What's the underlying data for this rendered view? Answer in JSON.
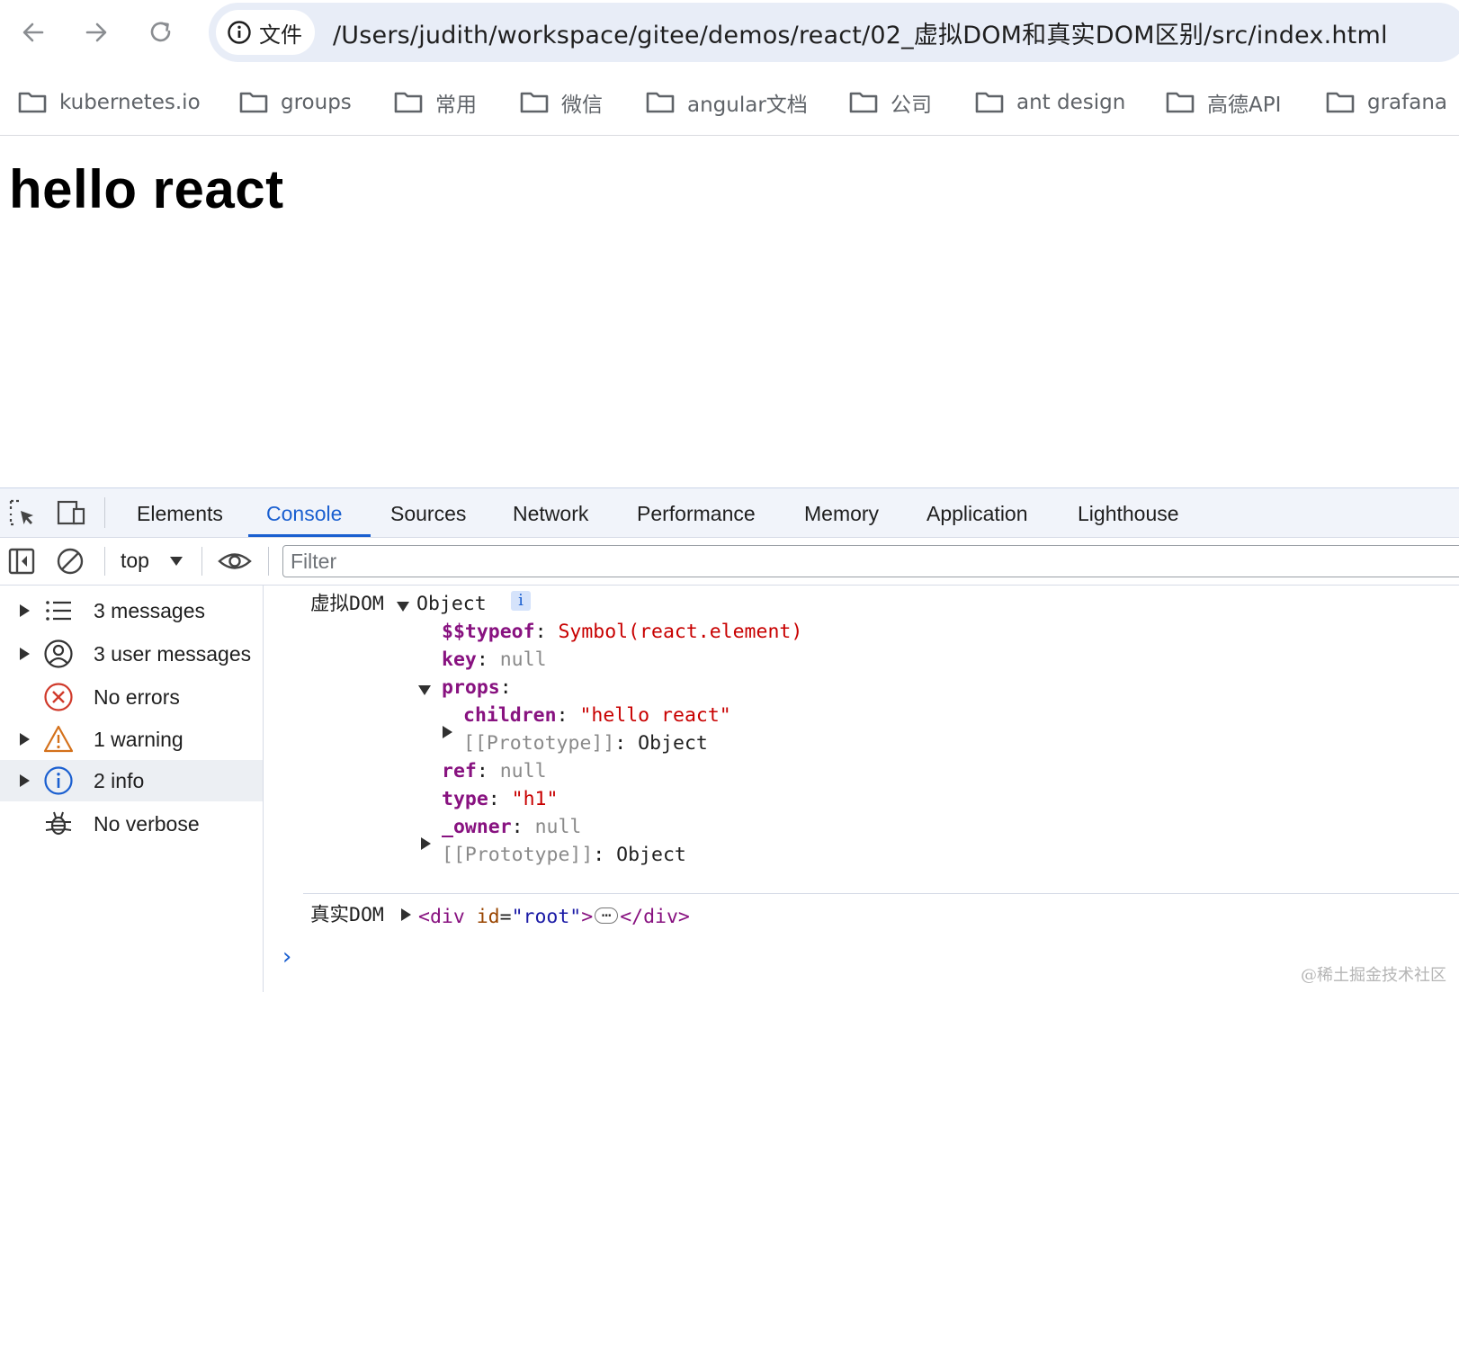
{
  "browser": {
    "site_info_label": "文件",
    "url": "/Users/judith/workspace/gitee/demos/react/02_虚拟DOM和真实DOM区别/src/index.html",
    "bookmarks": [
      "kubernetes.io",
      "groups",
      "常用",
      "微信",
      "angular文档",
      "公司",
      "ant design",
      "高德API",
      "grafana"
    ]
  },
  "page": {
    "heading": "hello react"
  },
  "devtools": {
    "tabs": [
      "Elements",
      "Console",
      "Sources",
      "Network",
      "Performance",
      "Memory",
      "Application",
      "Lighthouse"
    ],
    "active_tab": "Console",
    "accent_color": "#1a5fd0",
    "toolbar": {
      "context": "top",
      "filter_placeholder": "Filter"
    },
    "sidebar": [
      {
        "label": "3 messages",
        "icon": "list-icon",
        "expandable": true
      },
      {
        "label": "3 user messages",
        "icon": "user-icon",
        "expandable": true
      },
      {
        "label": "No errors",
        "icon": "error-icon",
        "expandable": false
      },
      {
        "label": "1 warning",
        "icon": "warning-icon",
        "expandable": true
      },
      {
        "label": "2 info",
        "icon": "info-icon",
        "expandable": true,
        "selected": true
      },
      {
        "label": "No verbose",
        "icon": "bug-icon",
        "expandable": false
      }
    ],
    "console": {
      "msg1": {
        "label": "虚拟DOM",
        "object_type": "Object",
        "info_badge": "i",
        "typeof_key": "$$typeof",
        "typeof_value": "Symbol(react.element)",
        "key_key": "key",
        "key_value": "null",
        "props_key": "props",
        "children_key": "children",
        "children_value": "\"hello react\"",
        "prototype_key": "[[Prototype]]",
        "prototype_value": "Object",
        "ref_key": "ref",
        "ref_value": "null",
        "type_key": "type",
        "type_value": "\"h1\"",
        "owner_key": "_owner",
        "owner_value": "null"
      },
      "msg2": {
        "label": "真实DOM",
        "tag_open": "<div",
        "attr_name": "id",
        "attr_value": "\"root\"",
        "tag_open_end": ">",
        "ellipsis": "…",
        "tag_close": "</div>"
      },
      "prompt": "›"
    }
  },
  "watermark": "@稀土掘金技术社区"
}
